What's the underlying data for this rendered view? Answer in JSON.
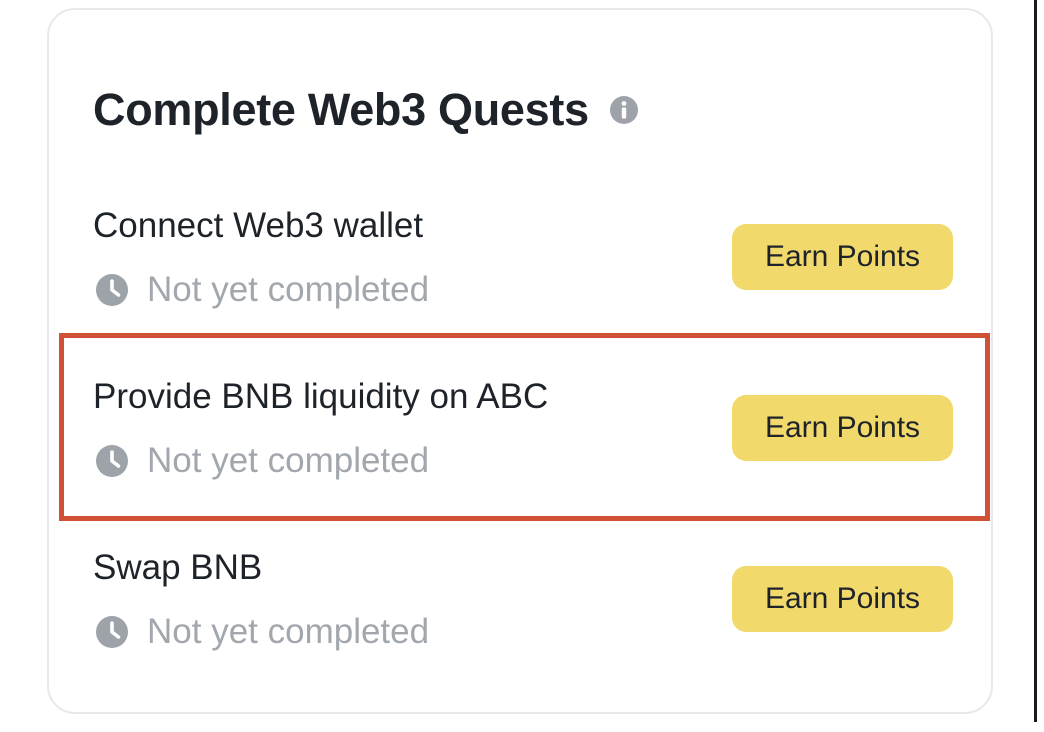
{
  "card": {
    "title": "Complete Web3 Quests",
    "info_icon": "info-circle-icon"
  },
  "quests": [
    {
      "name": "Connect Web3 wallet",
      "status": "Not yet completed",
      "status_icon": "clock-icon",
      "button_label": "Earn Points",
      "highlighted": false
    },
    {
      "name": "Provide BNB liquidity on ABC",
      "status": "Not yet completed",
      "status_icon": "clock-icon",
      "button_label": "Earn Points",
      "highlighted": true
    },
    {
      "name": "Swap BNB",
      "status": "Not yet completed",
      "status_icon": "clock-icon",
      "button_label": "Earn Points",
      "highlighted": false
    }
  ],
  "colors": {
    "button_background": "#f2d96b",
    "highlight_border": "#d05236",
    "title_text": "#1e2329",
    "muted_text": "#a2a7ae"
  }
}
